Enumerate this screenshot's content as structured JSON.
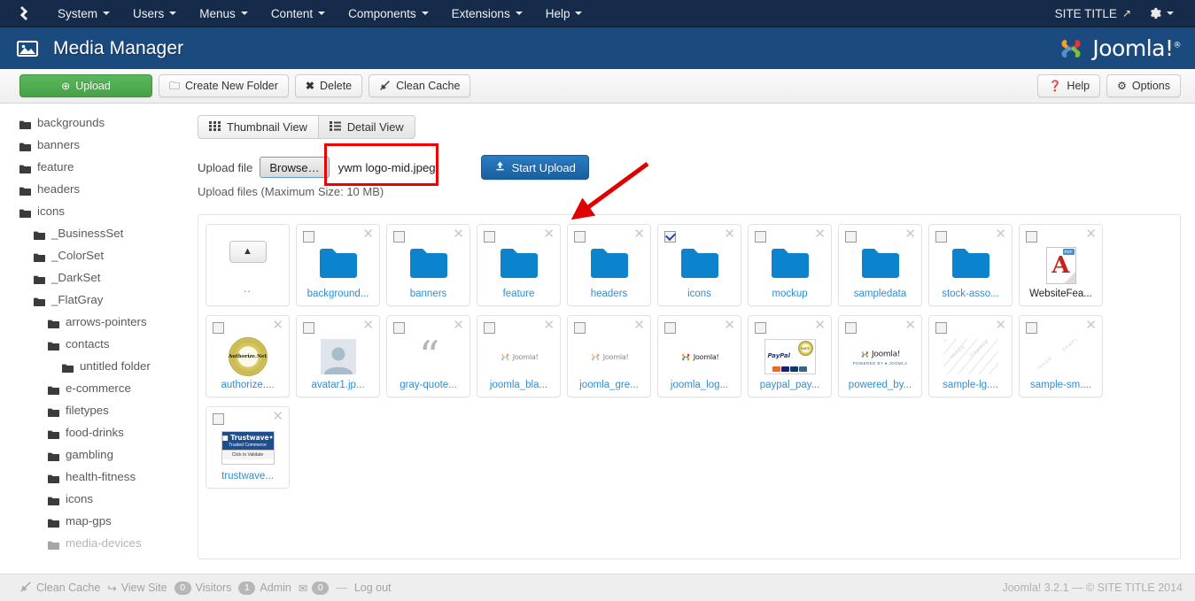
{
  "navbar": {
    "logo_icon": "joomla-logo-icon",
    "items": [
      {
        "label": "System",
        "caret": true
      },
      {
        "label": "Users",
        "caret": true
      },
      {
        "label": "Menus",
        "caret": true
      },
      {
        "label": "Content",
        "caret": true
      },
      {
        "label": "Components",
        "caret": true
      },
      {
        "label": "Extensions",
        "caret": true
      },
      {
        "label": "Help",
        "caret": true
      }
    ],
    "site_title": "SITE TITLE",
    "site_title_icon": "external-link-icon",
    "gear_icon": "gear-icon",
    "bg_color": "#152b49"
  },
  "subheader": {
    "page_icon": "image-icon",
    "title": "Media Manager",
    "brand_text": "Joomla!",
    "brand_reg": "®",
    "bg_color": "#1a4a7e"
  },
  "toolbar": {
    "upload_label": "Upload",
    "upload_icon": "plus-circle-icon",
    "create_folder_label": "Create New Folder",
    "create_folder_icon": "folder-icon",
    "delete_label": "Delete",
    "delete_icon": "x-icon",
    "clean_cache_label": "Clean Cache",
    "clean_cache_icon": "broom-icon",
    "help_label": "Help",
    "help_icon": "question-circle-icon",
    "options_label": "Options",
    "options_icon": "gear-icon",
    "upload_button_color": "#47a247"
  },
  "sidebar": {
    "items": [
      {
        "label": "backgrounds",
        "indent": 0
      },
      {
        "label": "banners",
        "indent": 0
      },
      {
        "label": "feature",
        "indent": 0
      },
      {
        "label": "headers",
        "indent": 0
      },
      {
        "label": "icons",
        "indent": 0
      },
      {
        "label": "_BusinessSet",
        "indent": 1
      },
      {
        "label": "_ColorSet",
        "indent": 1
      },
      {
        "label": "_DarkSet",
        "indent": 1
      },
      {
        "label": "_FlatGray",
        "indent": 1
      },
      {
        "label": "arrows-pointers",
        "indent": 2
      },
      {
        "label": "contacts",
        "indent": 2
      },
      {
        "label": "untitled folder",
        "indent": 3
      },
      {
        "label": "e-commerce",
        "indent": 2
      },
      {
        "label": "filetypes",
        "indent": 2
      },
      {
        "label": "food-drinks",
        "indent": 2
      },
      {
        "label": "gambling",
        "indent": 2
      },
      {
        "label": "health-fitness",
        "indent": 2
      },
      {
        "label": "icons",
        "indent": 2
      },
      {
        "label": "map-gps",
        "indent": 2
      },
      {
        "label": "media-devices",
        "indent": 2
      }
    ]
  },
  "view_tabs": [
    {
      "label": "Thumbnail View",
      "icon": "grid-icon",
      "active": true
    },
    {
      "label": "Detail View",
      "icon": "list-icon",
      "active": false
    }
  ],
  "upload": {
    "label": "Upload file",
    "browse_label": "Browse…",
    "file_name": "ywm logo-mid.jpeg",
    "start_upload_label": "Start Upload",
    "start_upload_icon": "upload-icon",
    "note": "Upload files (Maximum Size: 10 MB)",
    "highlight_color": "#ee0000",
    "annotation_arrow": "red-arrow-annotation"
  },
  "grid": {
    "parent_label": "..",
    "parent_icon": "up-arrow-icon",
    "items": [
      {
        "name": "background...",
        "type": "folder",
        "checked": false
      },
      {
        "name": "banners",
        "type": "folder",
        "checked": false
      },
      {
        "name": "feature",
        "type": "folder",
        "checked": false
      },
      {
        "name": "headers",
        "type": "folder",
        "checked": false
      },
      {
        "name": "icons",
        "type": "folder",
        "checked": true
      },
      {
        "name": "mockup",
        "type": "folder",
        "checked": false
      },
      {
        "name": "sampledata",
        "type": "folder",
        "checked": false
      },
      {
        "name": "stock-asso...",
        "type": "folder",
        "checked": false
      },
      {
        "name": "WebsiteFea...",
        "type": "pdf",
        "checked": false
      },
      {
        "name": "authorize....",
        "type": "authorize",
        "checked": false
      },
      {
        "name": "avatar1.jp...",
        "type": "avatar",
        "checked": false
      },
      {
        "name": "gray-quote...",
        "type": "quote",
        "checked": false
      },
      {
        "name": "joomla_bla...",
        "type": "joomla-logo-faint",
        "checked": false
      },
      {
        "name": "joomla_gre...",
        "type": "joomla-logo-faint",
        "checked": false
      },
      {
        "name": "joomla_log...",
        "type": "joomla-logo",
        "checked": false
      },
      {
        "name": "paypal_pay...",
        "type": "paypal",
        "checked": false
      },
      {
        "name": "powered_by...",
        "type": "powered-by-joomla",
        "checked": false
      },
      {
        "name": "sample-lg....",
        "type": "sample-image",
        "checked": false
      },
      {
        "name": "sample-sm....",
        "type": "sample-image-sm",
        "checked": false
      },
      {
        "name": "trustwave...",
        "type": "trustwave",
        "checked": false
      }
    ],
    "folder_color": "#0b84cd",
    "link_color": "#2f8ed4"
  },
  "footer": {
    "clean_cache_label": "Clean Cache",
    "clean_cache_icon": "broom-icon",
    "view_site_label": "View Site",
    "view_site_icon": "external-link-icon",
    "visitors_count": "0",
    "visitors_label": "Visitors",
    "admin_count": "1",
    "admin_label": "Admin",
    "mail_icon": "envelope-icon",
    "messages_count": "0",
    "dash": "—",
    "logout_label": "Log out",
    "copyright": "Joomla! 3.2.1  —  © SITE TITLE 2014"
  }
}
